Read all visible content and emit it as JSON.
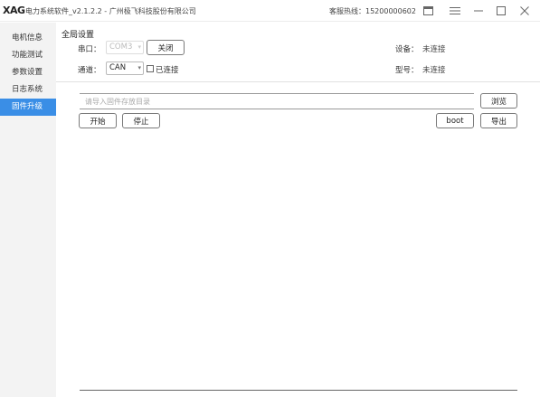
{
  "window": {
    "logo": "XAG",
    "title": "电力系统软件_v2.1.2.2 - 广州极飞科技股份有限公司",
    "hotline": "客服热线：15200000602",
    "controls": [
      "restore-icon",
      "menu-icon",
      "minimize-icon",
      "maximize-icon",
      "close-icon"
    ]
  },
  "sidebar": {
    "items": [
      {
        "label": "电机信息",
        "active": false
      },
      {
        "label": "功能测试",
        "active": false
      },
      {
        "label": "参数设置",
        "active": false
      },
      {
        "label": "日志系统",
        "active": false
      },
      {
        "label": "固件升级",
        "active": true
      }
    ]
  },
  "global_settings": {
    "title": "全局设置",
    "port_label": "串口：",
    "port_value": "COM3",
    "close_button": "关闭",
    "channel_label": "通道：",
    "channel_value": "CAN",
    "checkbox_label": "已连接",
    "device_label": "设备：",
    "device_value": "未连接",
    "model_label": "型号：",
    "model_value": "未连接"
  },
  "firmware": {
    "file_placeholder": "请导入固件存放目录",
    "browse_button": "浏览",
    "start_button": "开始",
    "stop_button": "停止",
    "boot_button": "boot",
    "export_button": "导出"
  },
  "colors": {
    "active_sidebar": "#3a8ee6",
    "sidebar_bg": "#f3f3f3"
  }
}
